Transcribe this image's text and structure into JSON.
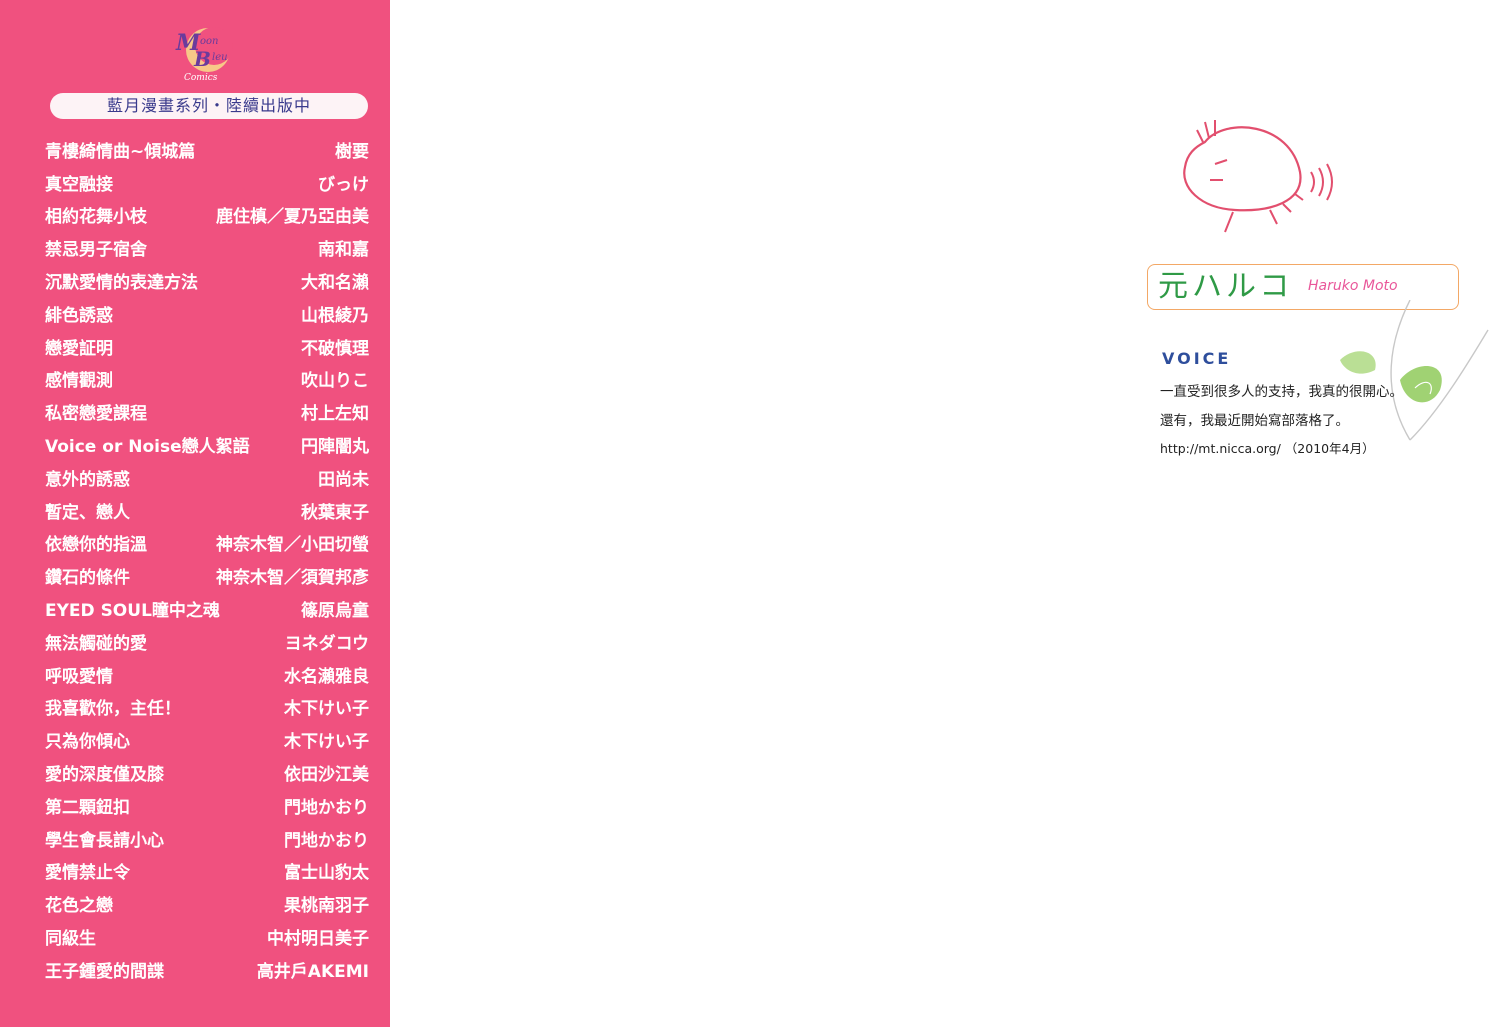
{
  "logo": {
    "text": "Moon Bleu Comics"
  },
  "series_banner": "藍月漫畫系列・陸續出版中",
  "books": [
    {
      "title": "青樓綺情曲~傾城篇",
      "author": "樹要"
    },
    {
      "title": "真空融接",
      "author": "びっけ"
    },
    {
      "title": "相約花舞小枝",
      "author": "鹿住槙／夏乃亞由美"
    },
    {
      "title": "禁忌男子宿舍",
      "author": "南和嘉"
    },
    {
      "title": "沉默愛情的表達方法",
      "author": "大和名瀨"
    },
    {
      "title": "緋色誘惑",
      "author": "山根綾乃"
    },
    {
      "title": "戀愛証明",
      "author": "不破慎理"
    },
    {
      "title": "感情觀測",
      "author": "吹山りこ"
    },
    {
      "title": "私密戀愛課程",
      "author": "村上左知"
    },
    {
      "title": "Voice or Noise戀人絮語",
      "author": "円陣闇丸"
    },
    {
      "title": "意外的誘惑",
      "author": "田尚未"
    },
    {
      "title": "暫定、戀人",
      "author": "秋葉東子"
    },
    {
      "title": "依戀你的指溫",
      "author": "神奈木智／小田切螢"
    },
    {
      "title": "鑽石的條件",
      "author": "神奈木智／須賀邦彥"
    },
    {
      "title": "EYED SOUL瞳中之魂",
      "author": "篠原烏童"
    },
    {
      "title": "無法觸碰的愛",
      "author": "ヨネダコウ"
    },
    {
      "title": "呼吸愛情",
      "author": "水名瀨雅良"
    },
    {
      "title": "我喜歡你，主任！",
      "author": "木下けい子"
    },
    {
      "title": "只為你傾心",
      "author": "木下けい子"
    },
    {
      "title": "愛的深度僅及膝",
      "author": "依田沙江美"
    },
    {
      "title": "第二顆鈕扣",
      "author": "門地かおり"
    },
    {
      "title": "學生會長請小心",
      "author": "門地かおり"
    },
    {
      "title": "愛情禁止令",
      "author": "富士山豹太"
    },
    {
      "title": "花色之戀",
      "author": "果桃南羽子"
    },
    {
      "title": "同級生",
      "author": "中村明日美子"
    },
    {
      "title": "王子鍾愛的間諜",
      "author": "高井戶AKEMI"
    }
  ],
  "author_profile": {
    "name_jp": "元ハルコ",
    "name_en": "Haruko Moto",
    "voice_heading": "VOICE",
    "voice_line1": "一直受到很多人的支持，我真的很開心。",
    "voice_line2": "還有，我最近開始寫部落格了。",
    "voice_line3": "http://mt.nicca.org/ （2010年4月）"
  },
  "colors": {
    "panel_pink": "#f0517f",
    "name_green": "#2f9a46",
    "name_pink": "#e9579a",
    "voice_blue": "#2e4e9c",
    "box_border": "#f3a866"
  }
}
